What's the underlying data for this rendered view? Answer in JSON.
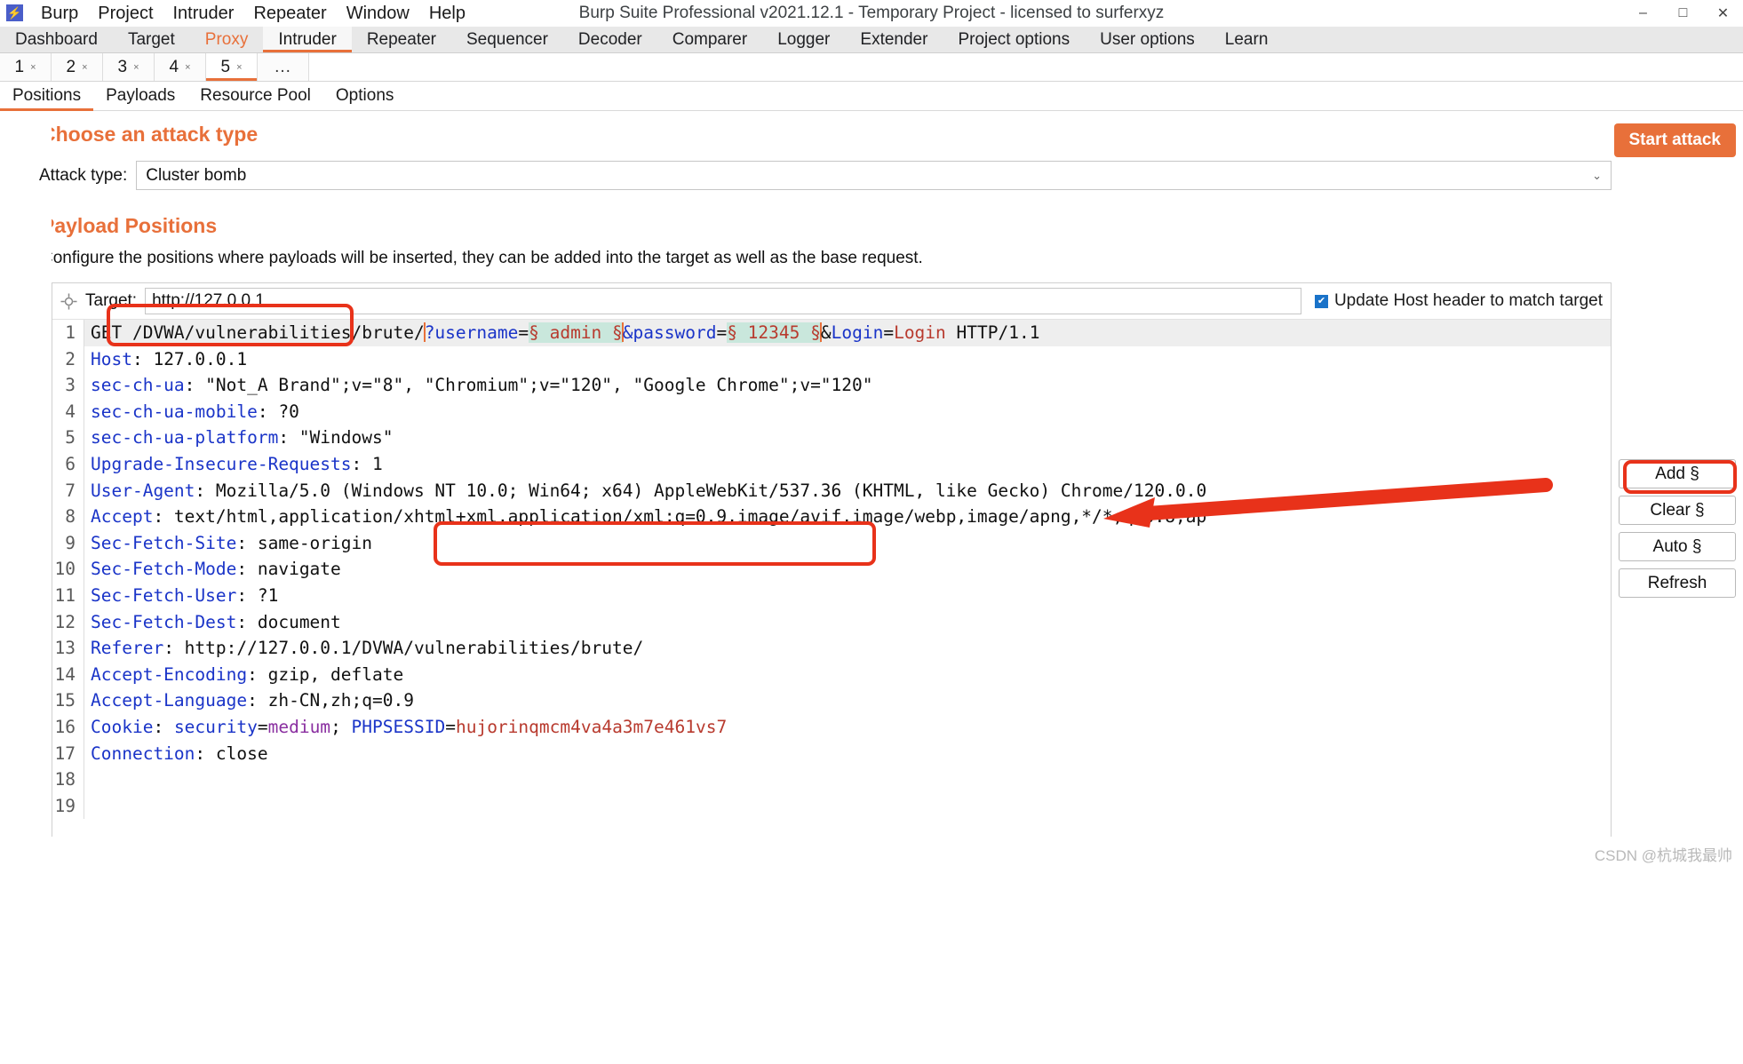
{
  "window": {
    "title": "Burp Suite Professional v2021.12.1 - Temporary Project - licensed to surferxyz",
    "logo_icon": "burp-logo-icon",
    "minimize_icon": "–",
    "maximize_icon": "□",
    "close_icon": "✕"
  },
  "menubar": {
    "items": [
      {
        "label": "Burp"
      },
      {
        "label": "Project"
      },
      {
        "label": "Intruder"
      },
      {
        "label": "Repeater"
      },
      {
        "label": "Window"
      },
      {
        "label": "Help"
      }
    ]
  },
  "main_tabs": [
    {
      "label": "Dashboard",
      "state": "normal"
    },
    {
      "label": "Target",
      "state": "normal"
    },
    {
      "label": "Proxy",
      "state": "accent"
    },
    {
      "label": "Intruder",
      "state": "active"
    },
    {
      "label": "Repeater",
      "state": "normal"
    },
    {
      "label": "Sequencer",
      "state": "normal"
    },
    {
      "label": "Decoder",
      "state": "normal"
    },
    {
      "label": "Comparer",
      "state": "normal"
    },
    {
      "label": "Logger",
      "state": "normal"
    },
    {
      "label": "Extender",
      "state": "normal"
    },
    {
      "label": "Project options",
      "state": "normal"
    },
    {
      "label": "User options",
      "state": "normal"
    },
    {
      "label": "Learn",
      "state": "normal"
    }
  ],
  "attack_tabs": {
    "items": [
      {
        "label": "1",
        "close": "×",
        "active": false
      },
      {
        "label": "2",
        "close": "×",
        "active": false
      },
      {
        "label": "3",
        "close": "×",
        "active": false
      },
      {
        "label": "4",
        "close": "×",
        "active": false
      },
      {
        "label": "5",
        "close": "×",
        "active": true
      }
    ],
    "more_label": "..."
  },
  "sub_tabs": [
    {
      "label": "Positions",
      "active": true
    },
    {
      "label": "Payloads",
      "active": false
    },
    {
      "label": "Resource Pool",
      "active": false
    },
    {
      "label": "Options",
      "active": false
    }
  ],
  "attack_type_section": {
    "help_icon": "?",
    "title": "Choose an attack type",
    "label": "Attack type:",
    "value": "Cluster bomb",
    "chevron_icon": "⌄",
    "start_attack_label": "Start attack"
  },
  "payload_positions_section": {
    "help_icon": "?",
    "title": "Payload Positions",
    "description": "Configure the positions where payloads will be inserted, they can be added into the target as well as the base request.",
    "target_icon": "crosshair-icon",
    "target_label": "Target:",
    "target_value": "http://127.0.0.1",
    "update_host_checkbox": {
      "checked": true,
      "check_glyph": "✔",
      "label": "Update Host header to match target"
    },
    "buttons": [
      {
        "label": "Add §"
      },
      {
        "label": "Clear §"
      },
      {
        "label": "Auto §"
      },
      {
        "label": "Refresh"
      }
    ]
  },
  "request": {
    "lines": [
      {
        "n": "1",
        "highlight": true,
        "tokens": [
          {
            "t": "GET /DVWA/vulnerabilities/brute/",
            "c": "k-val"
          },
          {
            "t": "",
            "c": "caret"
          },
          {
            "t": "?username",
            "c": "k-hdr"
          },
          {
            "t": "=",
            "c": "k-val"
          },
          {
            "t": "§ admin §",
            "c": "mark"
          },
          {
            "t": "",
            "c": "caret"
          },
          {
            "t": "&password",
            "c": "k-hdr"
          },
          {
            "t": "=",
            "c": "k-val"
          },
          {
            "t": "§ 12345 §",
            "c": "mark"
          },
          {
            "t": "",
            "c": "caret"
          },
          {
            "t": "&",
            "c": "k-val"
          },
          {
            "t": "Login",
            "c": "k-hdr"
          },
          {
            "t": "=",
            "c": "k-val"
          },
          {
            "t": "Login",
            "c": "k-red"
          },
          {
            "t": " HTTP/1.1",
            "c": "k-val"
          }
        ]
      },
      {
        "n": "2",
        "highlight": false,
        "tokens": [
          {
            "t": "Host",
            "c": "k-hdr"
          },
          {
            "t": ": 127.0.0.1",
            "c": "k-val"
          }
        ]
      },
      {
        "n": "3",
        "highlight": false,
        "tokens": [
          {
            "t": "sec-ch-ua",
            "c": "k-hdr"
          },
          {
            "t": ": \"Not_A Brand\";v=\"8\", \"Chromium\";v=\"120\", \"Google Chrome\";v=\"120\"",
            "c": "k-val"
          }
        ]
      },
      {
        "n": "4",
        "highlight": false,
        "tokens": [
          {
            "t": "sec-ch-ua-mobile",
            "c": "k-hdr"
          },
          {
            "t": ": ?0",
            "c": "k-val"
          }
        ]
      },
      {
        "n": "5",
        "highlight": false,
        "tokens": [
          {
            "t": "sec-ch-ua-platform",
            "c": "k-hdr"
          },
          {
            "t": ": \"Windows\"",
            "c": "k-val"
          }
        ]
      },
      {
        "n": "6",
        "highlight": false,
        "tokens": [
          {
            "t": "Upgrade-Insecure-Requests",
            "c": "k-hdr"
          },
          {
            "t": ": 1",
            "c": "k-val"
          }
        ]
      },
      {
        "n": "7",
        "highlight": false,
        "tokens": [
          {
            "t": "User-Agent",
            "c": "k-hdr"
          },
          {
            "t": ": Mozilla/5.0 (Windows NT 10.0; Win64; x64) AppleWebKit/537.36 (KHTML, like Gecko) Chrome/120.0.0",
            "c": "k-val"
          }
        ]
      },
      {
        "n": "8",
        "highlight": false,
        "tokens": [
          {
            "t": "Accept",
            "c": "k-hdr"
          },
          {
            "t": ": text/html,application/xhtml+xml,application/xml;q=0.9,image/avif,image/webp,image/apng,*/*;q=0.8,ap",
            "c": "k-val"
          }
        ]
      },
      {
        "n": "9",
        "highlight": false,
        "tokens": [
          {
            "t": "Sec-Fetch-Site",
            "c": "k-hdr"
          },
          {
            "t": ": same-origin",
            "c": "k-val"
          }
        ]
      },
      {
        "n": "10",
        "highlight": false,
        "tokens": [
          {
            "t": "Sec-Fetch-Mode",
            "c": "k-hdr"
          },
          {
            "t": ": navigate",
            "c": "k-val"
          }
        ]
      },
      {
        "n": "11",
        "highlight": false,
        "tokens": [
          {
            "t": "Sec-Fetch-User",
            "c": "k-hdr"
          },
          {
            "t": ": ?1",
            "c": "k-val"
          }
        ]
      },
      {
        "n": "12",
        "highlight": false,
        "tokens": [
          {
            "t": "Sec-Fetch-Dest",
            "c": "k-hdr"
          },
          {
            "t": ": document",
            "c": "k-val"
          }
        ]
      },
      {
        "n": "13",
        "highlight": false,
        "tokens": [
          {
            "t": "Referer",
            "c": "k-hdr"
          },
          {
            "t": ": http://127.0.0.1/DVWA/vulnerabilities/brute/",
            "c": "k-val"
          }
        ]
      },
      {
        "n": "14",
        "highlight": false,
        "tokens": [
          {
            "t": "Accept-Encoding",
            "c": "k-hdr"
          },
          {
            "t": ": gzip, deflate",
            "c": "k-val"
          }
        ]
      },
      {
        "n": "15",
        "highlight": false,
        "tokens": [
          {
            "t": "Accept-Language",
            "c": "k-hdr"
          },
          {
            "t": ": zh-CN,zh;q=0.9",
            "c": "k-val"
          }
        ]
      },
      {
        "n": "16",
        "highlight": false,
        "tokens": [
          {
            "t": "Cookie",
            "c": "k-hdr"
          },
          {
            "t": ": ",
            "c": "k-val"
          },
          {
            "t": "security",
            "c": "k-hdr"
          },
          {
            "t": "=",
            "c": "k-val"
          },
          {
            "t": "medium",
            "c": "k-purp"
          },
          {
            "t": "; ",
            "c": "k-val"
          },
          {
            "t": "PHPSESSID",
            "c": "k-hdr"
          },
          {
            "t": "=",
            "c": "k-val"
          },
          {
            "t": "hujorinqmcm4va4a3m7e461vs7",
            "c": "k-red"
          }
        ]
      },
      {
        "n": "17",
        "highlight": false,
        "tokens": [
          {
            "t": "Connection",
            "c": "k-hdr"
          },
          {
            "t": ": close",
            "c": "k-val"
          }
        ]
      },
      {
        "n": "18",
        "highlight": false,
        "tokens": []
      },
      {
        "n": "19",
        "highlight": false,
        "tokens": []
      }
    ]
  },
  "watermark": "CSDN @杭城我最帅",
  "colors": {
    "accent": "#e8703a",
    "annotation": "#e8321a",
    "header_key": "#1a34c8",
    "marker": "#c9e7dc",
    "marker_text": "#b83a2e"
  }
}
